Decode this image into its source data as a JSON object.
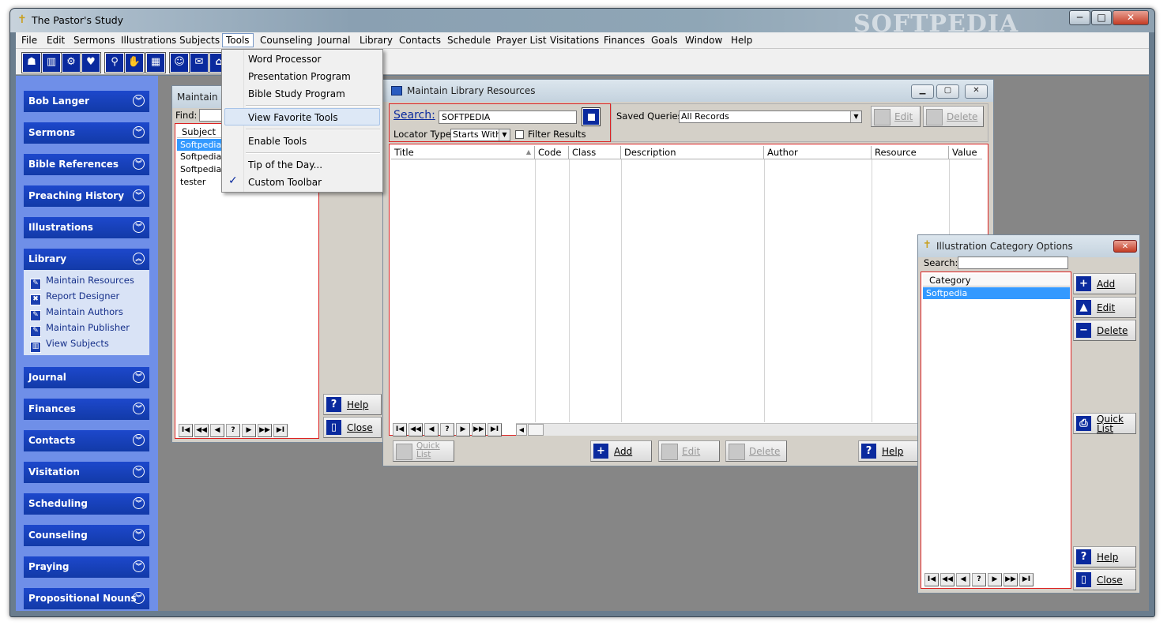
{
  "app": {
    "title": "The Pastor's Study",
    "watermark": "SOFTPEDIA",
    "min": "─",
    "max": "□",
    "close": "✕"
  },
  "menu": [
    "File",
    "Edit",
    "Sermons",
    "Illustrations",
    "Subjects",
    "Tools",
    "Counseling",
    "Journal",
    "Library",
    "Contacts",
    "Schedule",
    "Prayer List",
    "Visitations",
    "Finances",
    "Goals",
    "Window",
    "Help"
  ],
  "toolbar": {
    "icons": [
      "family-icon",
      "book-icon",
      "gear-icon",
      "heart-icon",
      "magnifier-icon",
      "hands-icon",
      "calendar-icon",
      "people-icon",
      "envelope-icon",
      "house-icon"
    ]
  },
  "sidebar": {
    "groups": [
      "Bob Langer",
      "Sermons",
      "Bible References",
      "Preaching History",
      "Illustrations",
      "Library",
      "Journal",
      "Finances",
      "Contacts",
      "Visitation",
      "Scheduling",
      "Counseling",
      "Praying",
      "Propositional Nouns"
    ],
    "library_items": [
      "Maintain Resources",
      "Report Designer",
      "Maintain Authors",
      "Maintain Publisher",
      "View Subjects"
    ]
  },
  "tools_menu": {
    "items": [
      "Word Processor",
      "Presentation Program",
      "Bible Study Program",
      "View Favorite Tools",
      "Enable Tools",
      "Tip of the Day...",
      "Custom Toolbar"
    ],
    "check": "✓"
  },
  "subjects_win": {
    "title": "Maintain S",
    "find_label": "Find:",
    "column": "Subject",
    "rows": [
      "Softpedia",
      "Softpedia T",
      "Softpedia T",
      "tester"
    ],
    "help": "Help",
    "close": "Close"
  },
  "library_win": {
    "title": "Maintain Library Resources",
    "search_label": "Search:",
    "search_value": "SOFTPEDIA",
    "locator_label": "Locator Type:",
    "locator_value": "Starts With",
    "filter_label": "Filter Results",
    "saved_label": "Saved Queries:",
    "saved_value": "All Records",
    "edit_top": "Edit",
    "delete_top": "Delete",
    "columns": [
      "Title",
      "Code",
      "Class",
      "Description",
      "Author",
      "Resource",
      "Value"
    ],
    "quick_list": "Quick List",
    "add": "Add",
    "edit": "Edit",
    "delete": "Delete",
    "help": "Help"
  },
  "category_win": {
    "title": "Illustration Category Options",
    "search_label": "Search:",
    "column": "Category",
    "rows": [
      "Softpedia"
    ],
    "add": "Add",
    "edit": "Edit",
    "delete": "Delete",
    "quick": "Quick",
    "list": "List",
    "help": "Help",
    "close": "Close"
  },
  "nav": [
    "I◀",
    "◀◀",
    "◀",
    "?",
    "▶",
    "▶▶",
    "▶I"
  ],
  "colors": {
    "accent": "#1d48cc",
    "sidebar": "#6f8fe8",
    "selection": "#3399ff",
    "mdi": "#868686"
  }
}
